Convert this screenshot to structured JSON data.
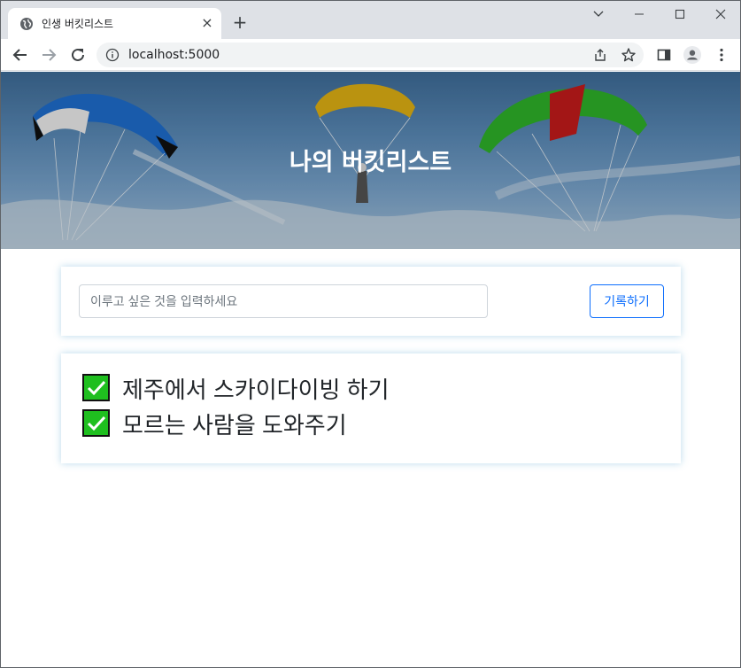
{
  "browser": {
    "tab_title": "인생 버킷리스트",
    "new_tab": "+",
    "url": "localhost:5000"
  },
  "header": {
    "title": "나의 버킷리스트"
  },
  "form": {
    "placeholder": "이루고 싶은 것을 입력하세요",
    "button_label": "기록하기"
  },
  "bucket_list": [
    {
      "text": "제주에서 스카이다이빙 하기",
      "done": true
    },
    {
      "text": "모르는 사람을 도와주기",
      "done": true
    }
  ],
  "colors": {
    "accent": "#0d6efd",
    "check": "#1fbf1f"
  }
}
